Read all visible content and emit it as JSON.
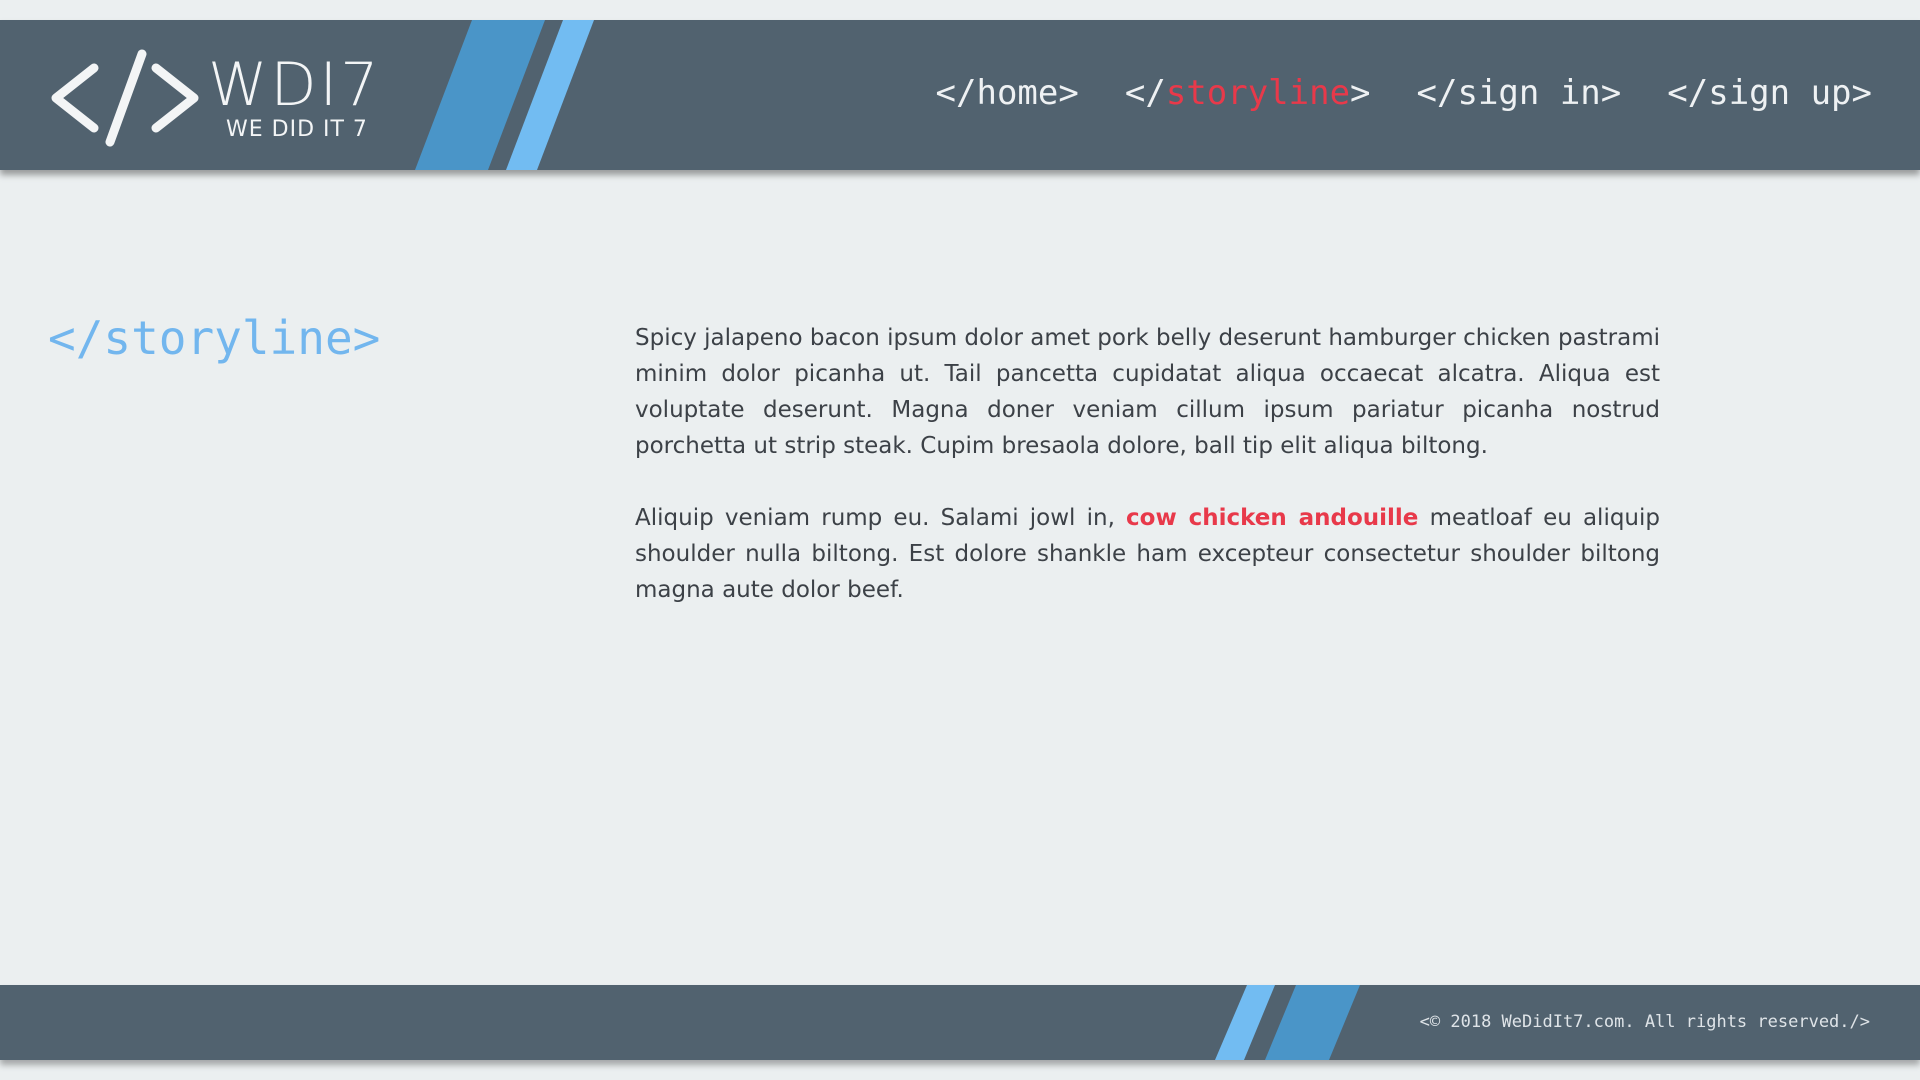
{
  "brand": {
    "logo_mark": "</>",
    "name": "WDI7",
    "tagline": "WE DID IT 7"
  },
  "nav": {
    "items": [
      {
        "prefix": "</",
        "label": "home",
        "suffix": ">",
        "active": false
      },
      {
        "prefix": "</",
        "label": "storyline",
        "suffix": ">",
        "active": true
      },
      {
        "prefix": "</",
        "label": "sign in",
        "suffix": ">",
        "active": false
      },
      {
        "prefix": "</",
        "label": "sign up",
        "suffix": ">",
        "active": false
      }
    ]
  },
  "main": {
    "section_title": "</storyline>",
    "paragraph1": "Spicy jalapeno bacon ipsum dolor amet pork belly deserunt hamburger chicken pastrami minim dolor picanha ut. Tail pancetta cupidatat aliqua occaecat alcatra. Aliqua est voluptate deserunt. Magna doner veniam cillum ipsum pariatur picanha nostrud porchetta ut strip steak. Cupim bresaola dolore, ball tip elit aliqua biltong.",
    "paragraph2_before": "Aliquip veniam rump eu. Salami jowl in, ",
    "paragraph2_highlight": "cow chicken andouille",
    "paragraph2_after": " meatloaf eu aliquip shoulder nulla biltong. Est dolore shankle ham excepteur consectetur shoulder biltong magna aute dolor beef."
  },
  "footer": {
    "copyright": "<© 2018 WeDidIt7.com. All rights reserved./>"
  },
  "colors": {
    "header_bg": "#51626f",
    "page_bg": "#ebeff0",
    "accent_red": "#e8394a",
    "accent_blue": "#72b6ee",
    "stripe_dark": "#4a95c8",
    "stripe_light": "#72bcf2"
  }
}
